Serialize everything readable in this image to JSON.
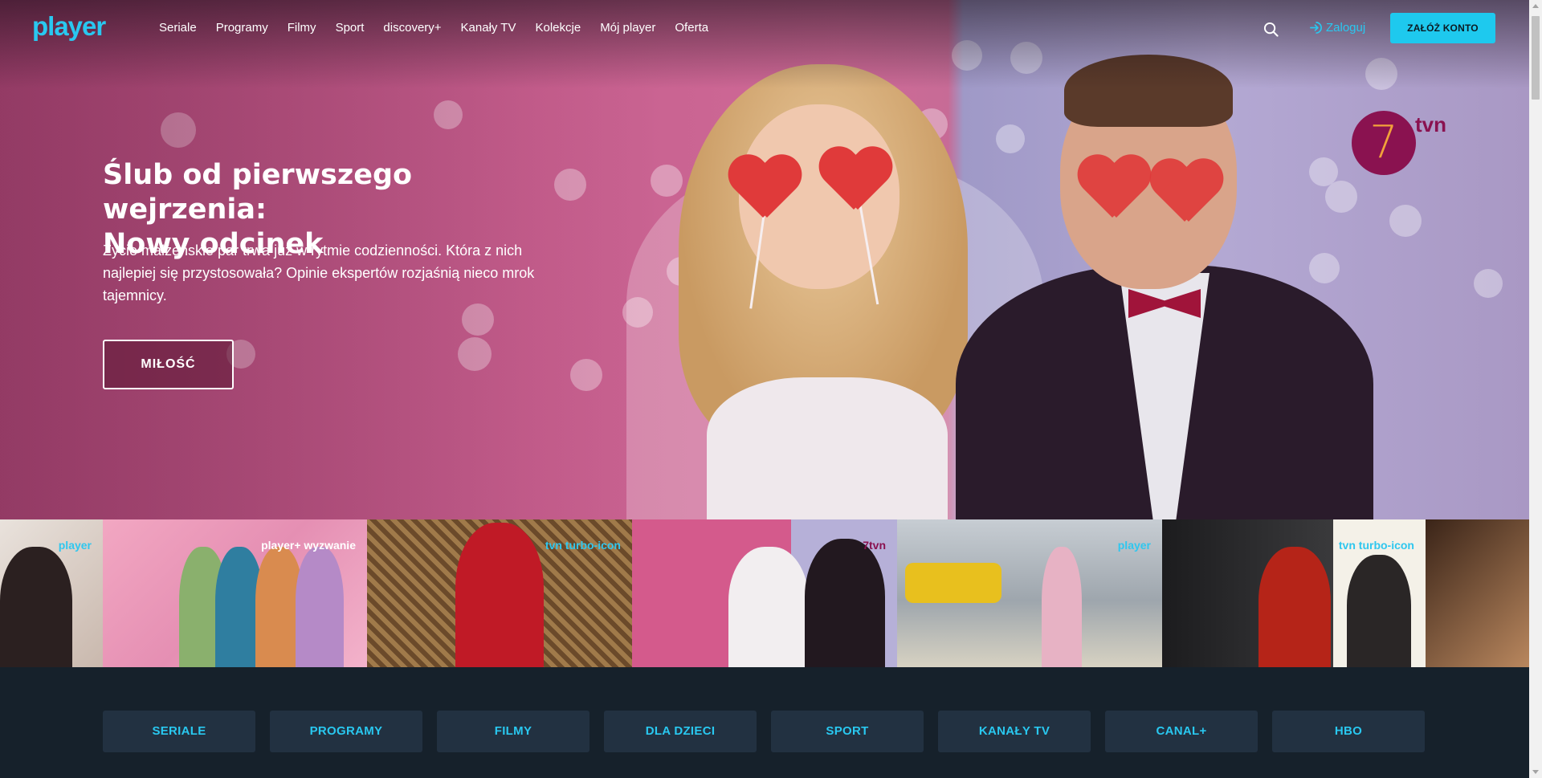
{
  "nav": {
    "logo": "player",
    "menu": [
      "Seriale",
      "Programy",
      "Filmy",
      "Sport",
      "discovery+",
      "Kanały TV",
      "Kolekcje",
      "Mój player",
      "Oferta"
    ],
    "login_label": "Zaloguj",
    "cta_label": "ZAŁÓŻ KONTO"
  },
  "hero": {
    "title_line1": "Ślub od pierwszego wejrzenia:",
    "title_line2": "Nowy odcinek",
    "description": "Życie małżeńskie par trwa już w rytmie codzienności. Która z nich najlepiej się przystosowała? Opinie ekspertów rozjaśnią nieco mrok tajemnicy.",
    "button_label": "MIŁOŚĆ",
    "channel_logo_number": "7",
    "channel_logo_text": "tvn"
  },
  "thumbnails": [
    {
      "badge": "player"
    },
    {
      "badge": "player+ wyzwanie"
    },
    {
      "badge": "tvn turbo-icon"
    },
    {
      "badge": "7tvn"
    },
    {
      "badge": "player"
    },
    {
      "badge": "tvn turbo-icon"
    },
    {
      "badge": ""
    }
  ],
  "categories": [
    "SERIALE",
    "PROGRAMY",
    "FILMY",
    "DLA DZIECI",
    "SPORT",
    "KANAŁY TV",
    "CANAL+",
    "HBO"
  ],
  "colors": {
    "accent": "#1ec9ee",
    "category_bg": "#223141",
    "page_bg": "#16212b"
  }
}
